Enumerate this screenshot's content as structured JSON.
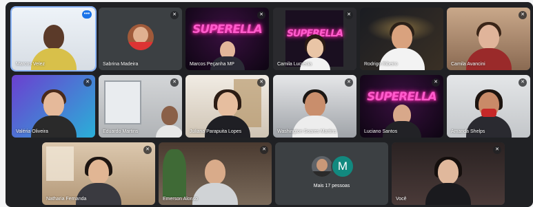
{
  "participants": [
    {
      "name": "Marcos Velez"
    },
    {
      "name": "Sabrina Madeira"
    },
    {
      "name": "Marcos Peçanha MP"
    },
    {
      "name": "Camila Lucrecia"
    },
    {
      "name": "Rodrigo Ribeiro"
    },
    {
      "name": "Camila Avancini"
    },
    {
      "name": "Valéria Oliveira"
    },
    {
      "name": "Eduardo Martins"
    },
    {
      "name": "Juliana Parapuita Lopes"
    },
    {
      "name": "Washington Soares Martins"
    },
    {
      "name": "Luciano Santos"
    },
    {
      "name": "Amanda Shelps"
    },
    {
      "name": "Natharia Fernanda"
    },
    {
      "name": "Emerson Alonso"
    },
    {
      "name": "Você"
    }
  ],
  "virtual_background_text": "SUPERELLA",
  "more": {
    "label": "Mais 17 pessoas",
    "avatar_letter": "M"
  },
  "colors": {
    "stage": "#202124",
    "tile": "#3c4043",
    "accent": "#1a73e8",
    "neon": "#ff5ccc",
    "avatar_teal": "#12897f"
  },
  "icons": {
    "muted": "mic-off-icon",
    "speaking": "audio-wave-icon"
  }
}
